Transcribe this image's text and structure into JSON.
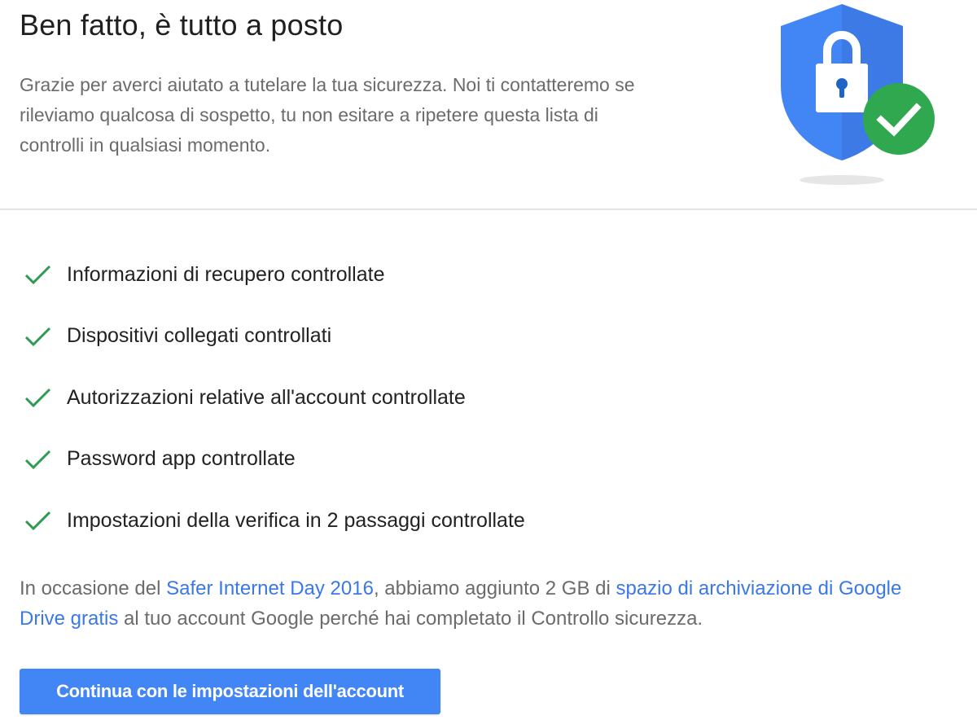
{
  "header": {
    "title": "Ben fatto, è tutto a posto",
    "intro": "Grazie per averci aiutato a tutelare la tua sicurezza. Noi ti contatteremo se rileviamo qualcosa di sospetto, tu non esitare a ripetere questa lista di controlli in qualsiasi momento."
  },
  "illustration": {
    "icon": "shield-lock-check-icon",
    "colors": {
      "shield": "#4285f4",
      "shield_dark": "#3a73d8",
      "lock": "#ffffff",
      "check_badge": "#2fa84f"
    }
  },
  "checks": {
    "icon": "checkmark-icon",
    "color": "#2e9b52",
    "items": [
      {
        "label": "Informazioni di recupero controllate"
      },
      {
        "label": "Dispositivi collegati controllati"
      },
      {
        "label": "Autorizzazioni relative all'account controllate"
      },
      {
        "label": "Password app controllate"
      },
      {
        "label": "Impostazioni della verifica in 2 passaggi controllate"
      }
    ]
  },
  "note": {
    "part1": "In occasione del ",
    "link1": "Safer Internet Day 2016",
    "part2": ", abbiamo aggiunto 2 GB di ",
    "link2": "spazio di archiviazione di Google Drive gratis",
    "part3": " al tuo account Google perché hai completato il Controllo sicurezza.",
    "link_color": "#3b78e7"
  },
  "button": {
    "label": "Continua con le impostazioni dell'account",
    "color": "#4285f4"
  }
}
